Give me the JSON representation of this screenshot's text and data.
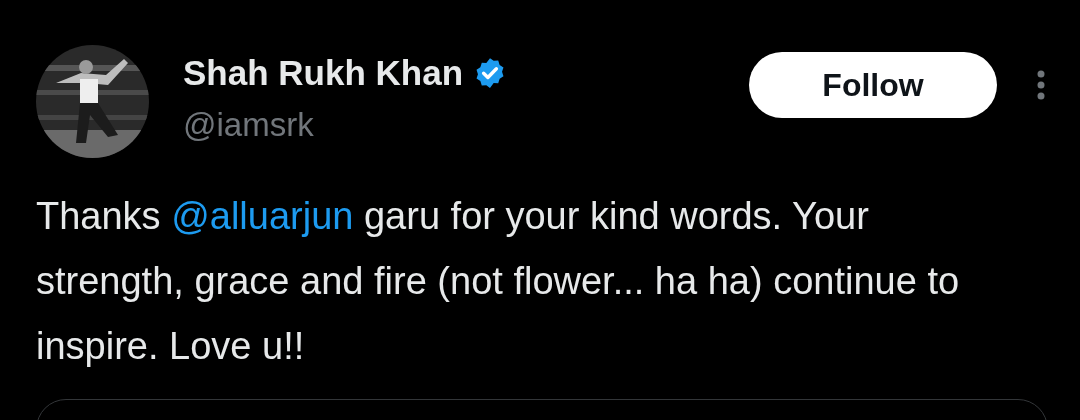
{
  "author": {
    "name": "Shah Rukh Khan",
    "verified": true,
    "handle": "@iamsrk"
  },
  "follow_button": {
    "label": "Follow"
  },
  "tweet_text": [
    {
      "kind": "text",
      "text": "Thanks "
    },
    {
      "kind": "mention",
      "text": "@alluarjun"
    },
    {
      "kind": "text",
      "text": " garu for your kind words. Your strength, grace and fire (not flower... ha ha) continue to inspire. Love u!!"
    }
  ],
  "quoted_card": {
    "kind": "card"
  }
}
